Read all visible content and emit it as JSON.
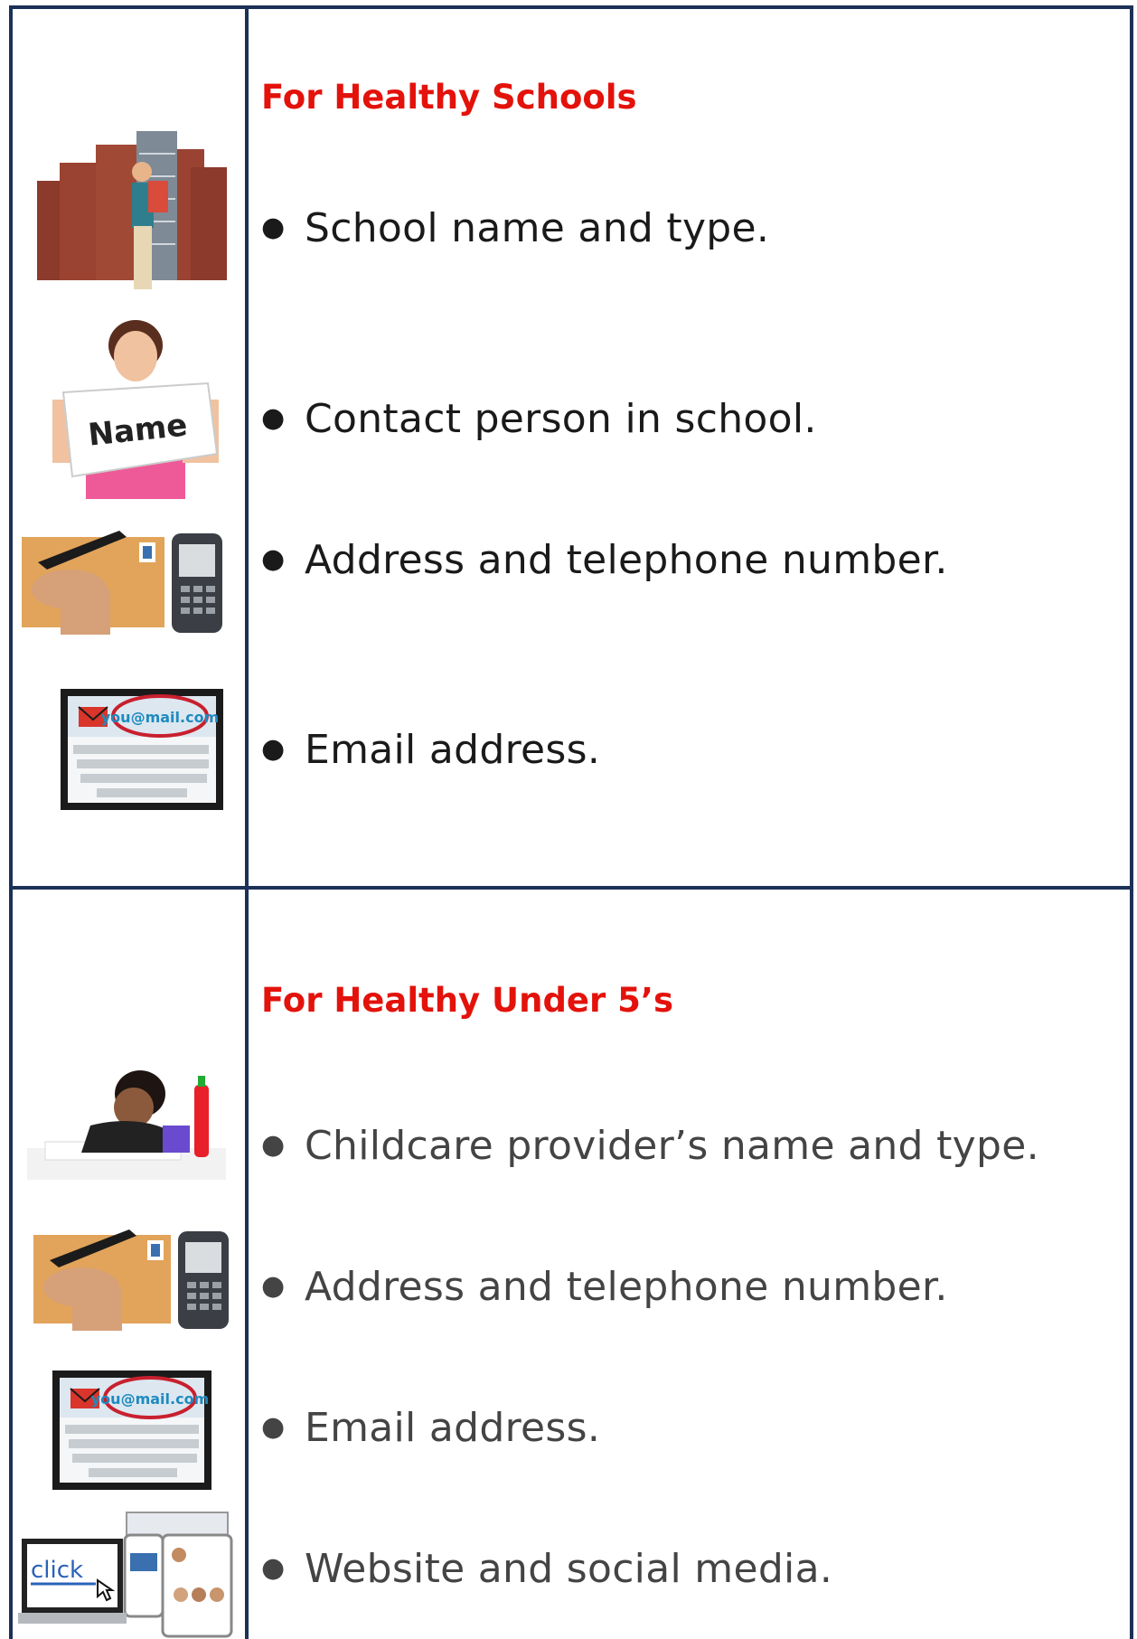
{
  "sections": [
    {
      "heading": "For Healthy Schools",
      "items": [
        {
          "text": "School name and type.",
          "icon": "school-building-icon"
        },
        {
          "text": "Contact person in school.",
          "icon": "name-sign-icon"
        },
        {
          "text": "Address and telephone number.",
          "icon": "letter-and-phone-icon"
        },
        {
          "text": "Email address.",
          "icon": "email-tablet-icon"
        }
      ]
    },
    {
      "heading": "For Healthy Under 5’s",
      "items": [
        {
          "text": "Childcare provider’s name and type.",
          "icon": "child-drawing-icon"
        },
        {
          "text": "Address and telephone number.",
          "icon": "letter-and-phone-icon"
        },
        {
          "text": "Email address.",
          "icon": "email-tablet-icon"
        },
        {
          "text": "Website and social media.",
          "icon": "devices-click-icon"
        }
      ]
    }
  ],
  "picture_text": {
    "name_sign": "Name",
    "email": "you@mail.com",
    "click": "click"
  },
  "colors": {
    "border": "#1c3158",
    "heading": "#e3120b",
    "text_dark": "#1a1a1a",
    "text_grey": "#444444"
  }
}
